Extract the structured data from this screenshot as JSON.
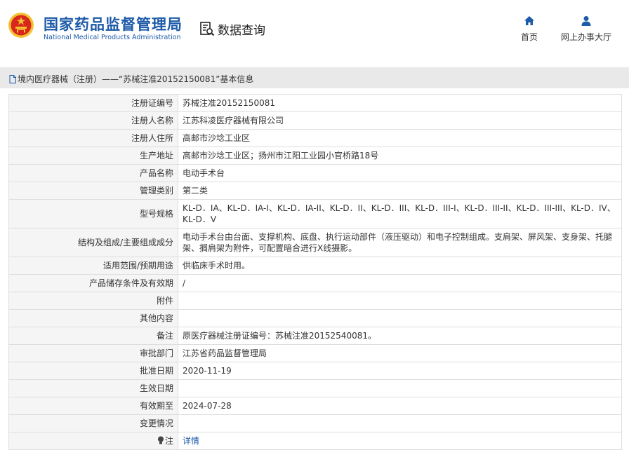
{
  "header": {
    "org_name_cn": "国家药品监督管理局",
    "org_name_en": "National Medical Products Administration",
    "query_label": "数据查询",
    "nav": [
      {
        "label": "首页",
        "icon": "home-icon"
      },
      {
        "label": "网上办事大厅",
        "icon": "user-icon"
      }
    ]
  },
  "breadcrumb": {
    "text": "境内医疗器械（注册）——“苏械注准20152150081”基本信息"
  },
  "table": {
    "rows": [
      {
        "key": "注册证编号",
        "value": "苏械注准20152150081"
      },
      {
        "key": "注册人名称",
        "value": "江苏科凌医疗器械有限公司"
      },
      {
        "key": "注册人住所",
        "value": "高邮市沙埝工业区"
      },
      {
        "key": "生产地址",
        "value": "高邮市沙埝工业区；扬州市江阳工业园小官桥路18号"
      },
      {
        "key": "产品名称",
        "value": "电动手术台"
      },
      {
        "key": "管理类别",
        "value": "第二类"
      },
      {
        "key": "型号规格",
        "value": "KL-D．IA、KL-D．IA-I、KL-D．IA-II、KL-D．II、KL-D．III、KL-D．III-I、KL-D．III-II、KL-D．III-III、KL-D．IV、KL-D．V"
      },
      {
        "key": "结构及组成/主要组成成分",
        "value": "电动手术台由台面、支撑机构、底盘、执行运动部件（液压驱动）和电子控制组成。支肩架、屏风架、支身架、托腿架、搁肩架为附件，可配置暗合进行X线摄影。"
      },
      {
        "key": "适用范围/预期用途",
        "value": "供临床手术时用。"
      },
      {
        "key": "产品储存条件及有效期",
        "value": "/"
      },
      {
        "key": "附件",
        "value": ""
      },
      {
        "key": "其他内容",
        "value": ""
      },
      {
        "key": "备注",
        "value": "原医疗器械注册证编号：苏械注准20152540081。"
      },
      {
        "key": "审批部门",
        "value": "江苏省药品监督管理局"
      },
      {
        "key": "批准日期",
        "value": "2020-11-19"
      },
      {
        "key": "生效日期",
        "value": ""
      },
      {
        "key": "有效期至",
        "value": "2024-07-28"
      },
      {
        "key": "变更情况",
        "value": ""
      }
    ],
    "note_row": {
      "key": "注",
      "value": "详情"
    }
  },
  "colors": {
    "brand_blue": "#1d5aa8",
    "emblem_red": "#d9261c",
    "emblem_gold": "#f2c230"
  }
}
